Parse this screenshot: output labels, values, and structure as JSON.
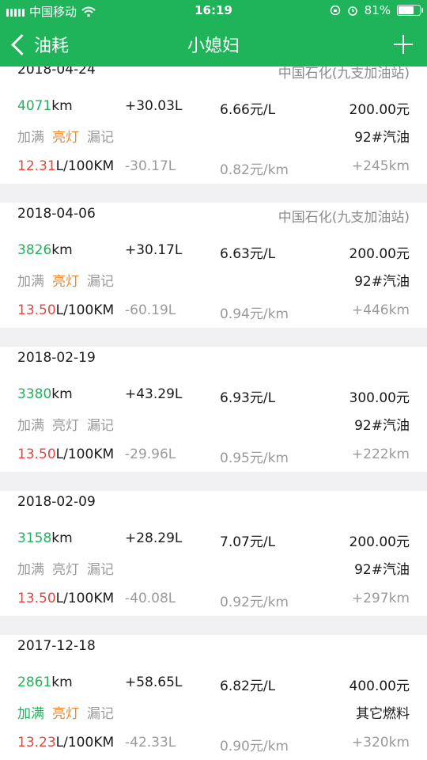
{
  "status_bar": {
    "carrier": "中国移动",
    "time": "16:19",
    "battery": "81%",
    "battery_level": 0.81
  },
  "nav": {
    "back_label": "油耗",
    "title": "小媳妇"
  },
  "colors": {
    "accent": "#1fb35a",
    "orange": "#f0882b",
    "red": "#e8453c",
    "muted": "#9a9a9a"
  },
  "records": [
    {
      "date": "2018-04-24",
      "station": "中国石化(九支加油站)",
      "odometer_num": "4071",
      "odometer_unit": "km",
      "volume": "+30.03L",
      "price": "6.66元/L",
      "amount": "200.00元",
      "tags": [
        {
          "label": "加满",
          "state": "off"
        },
        {
          "label": "亮灯",
          "state": "on"
        },
        {
          "label": "漏记",
          "state": "off"
        }
      ],
      "fuel_type": "92#汽油",
      "consumption_num": "12.31",
      "consumption_unit": "L/100KM",
      "diff": "-30.17L",
      "cost_per_km": "0.82元/km",
      "distance": "+245km"
    },
    {
      "date": "2018-04-06",
      "station": "中国石化(九支加油站)",
      "odometer_num": "3826",
      "odometer_unit": "km",
      "volume": "+30.17L",
      "price": "6.63元/L",
      "amount": "200.00元",
      "tags": [
        {
          "label": "加满",
          "state": "off"
        },
        {
          "label": "亮灯",
          "state": "on"
        },
        {
          "label": "漏记",
          "state": "off"
        }
      ],
      "fuel_type": "92#汽油",
      "consumption_num": "13.50",
      "consumption_unit": "L/100KM",
      "diff": "-60.19L",
      "cost_per_km": "0.94元/km",
      "distance": "+446km"
    },
    {
      "date": "2018-02-19",
      "station": "",
      "odometer_num": "3380",
      "odometer_unit": "km",
      "volume": "+43.29L",
      "price": "6.93元/L",
      "amount": "300.00元",
      "tags": [
        {
          "label": "加满",
          "state": "off"
        },
        {
          "label": "亮灯",
          "state": "off"
        },
        {
          "label": "漏记",
          "state": "off"
        }
      ],
      "fuel_type": "92#汽油",
      "consumption_num": "13.50",
      "consumption_unit": "L/100KM",
      "diff": "-29.96L",
      "cost_per_km": "0.95元/km",
      "distance": "+222km"
    },
    {
      "date": "2018-02-09",
      "station": "",
      "odometer_num": "3158",
      "odometer_unit": "km",
      "volume": "+28.29L",
      "price": "7.07元/L",
      "amount": "200.00元",
      "tags": [
        {
          "label": "加满",
          "state": "off"
        },
        {
          "label": "亮灯",
          "state": "off"
        },
        {
          "label": "漏记",
          "state": "off"
        }
      ],
      "fuel_type": "92#汽油",
      "consumption_num": "13.50",
      "consumption_unit": "L/100KM",
      "diff": "-40.08L",
      "cost_per_km": "0.92元/km",
      "distance": "+297km"
    },
    {
      "date": "2017-12-18",
      "station": "",
      "odometer_num": "2861",
      "odometer_unit": "km",
      "volume": "+58.65L",
      "price": "6.82元/L",
      "amount": "400.00元",
      "tags": [
        {
          "label": "加满",
          "state": "full"
        },
        {
          "label": "亮灯",
          "state": "on"
        },
        {
          "label": "漏记",
          "state": "off"
        }
      ],
      "fuel_type": "其它燃料",
      "consumption_num": "13.23",
      "consumption_unit": "L/100KM",
      "diff": "-42.33L",
      "cost_per_km": "0.90元/km",
      "distance": "+320km"
    }
  ]
}
